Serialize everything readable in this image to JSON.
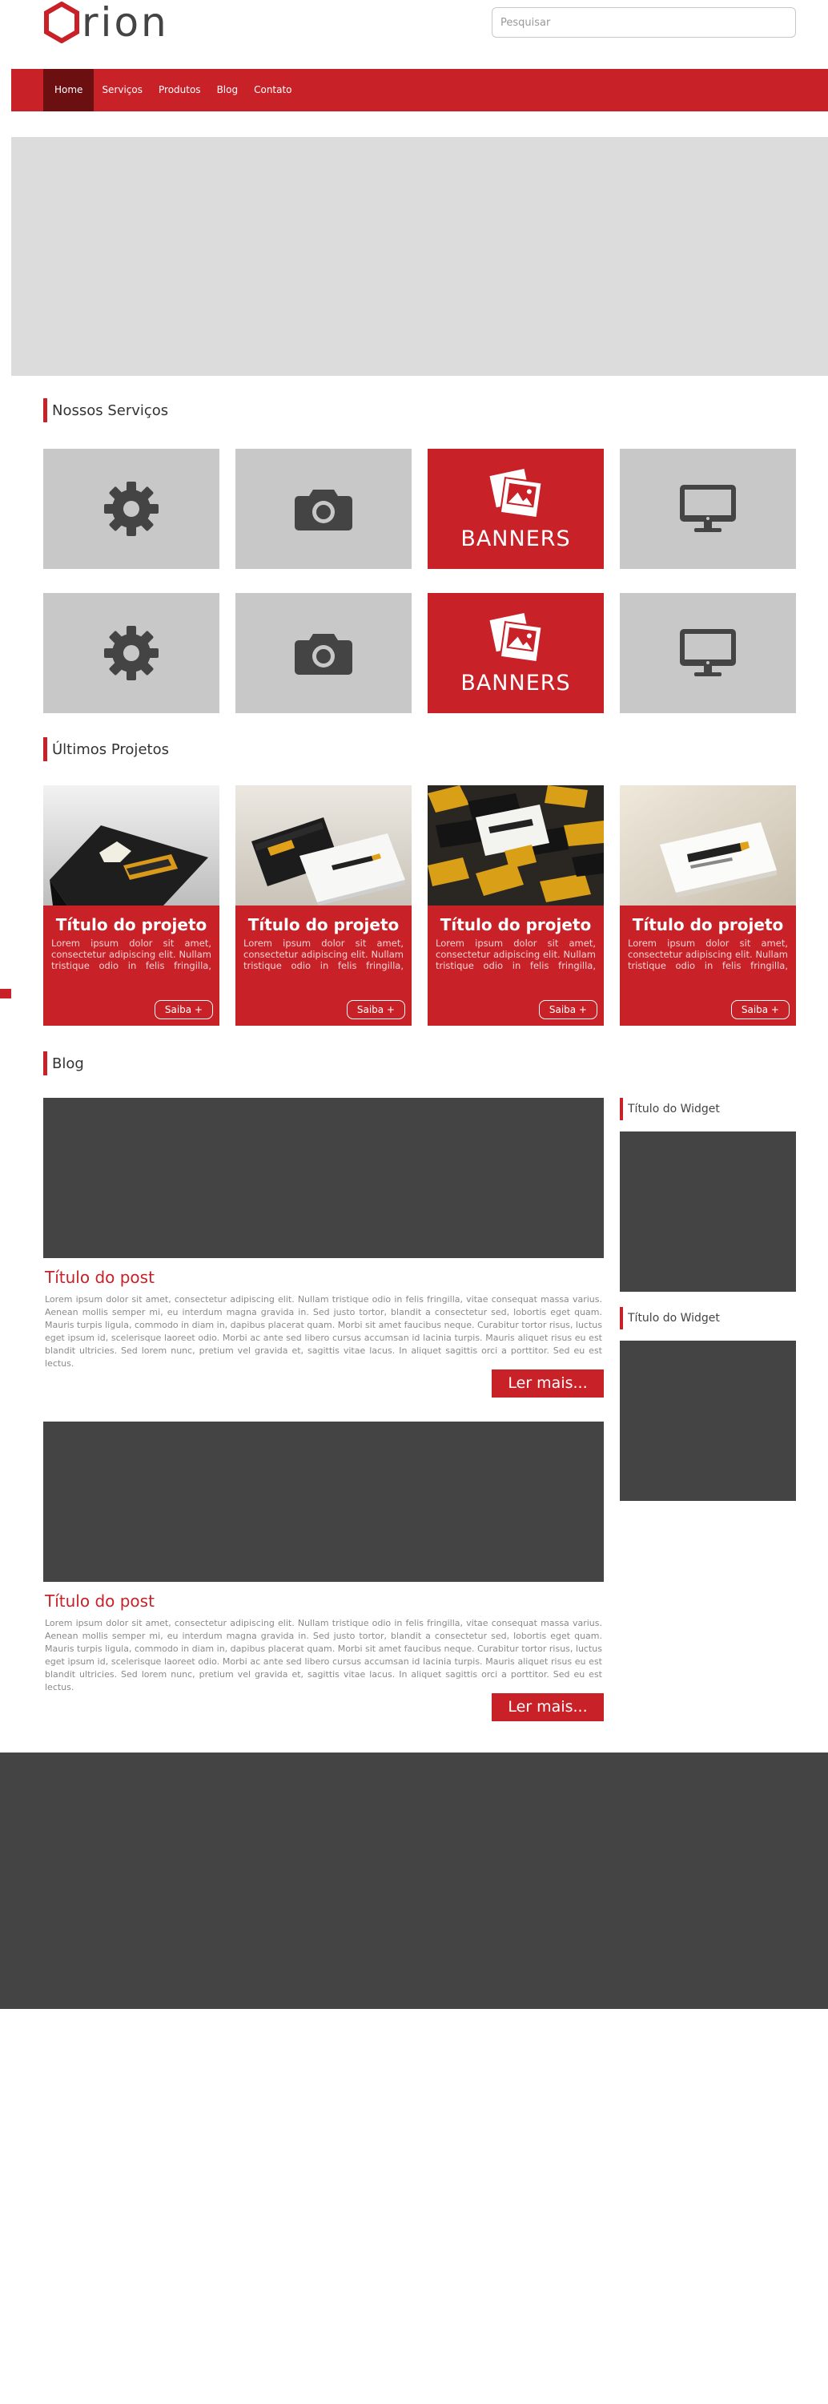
{
  "header": {
    "logo_text": "rion",
    "search_placeholder": "Pesquisar"
  },
  "nav": {
    "items": [
      "Home",
      "Serviços",
      "Produtos",
      "Blog",
      "Contato"
    ],
    "active": "Home"
  },
  "services": {
    "title": "Nossos Serviços",
    "tiles": [
      {
        "icon": "gear-icon"
      },
      {
        "icon": "camera-icon"
      },
      {
        "icon": "photos-icon",
        "label": "BANNERS"
      },
      {
        "icon": "monitor-icon"
      },
      {
        "icon": "gear-icon"
      },
      {
        "icon": "camera-icon"
      },
      {
        "icon": "photos-icon",
        "label": "BANNERS"
      },
      {
        "icon": "monitor-icon"
      }
    ]
  },
  "projects": {
    "title": "Últimos Projetos",
    "items": [
      {
        "title": "Título do projeto",
        "description": "Lorem ipsum dolor sit amet, consectetur adipiscing elit. Nullam tristique odio in felis fringilla, vitae consequat massa varius...",
        "button": "Saiba +"
      },
      {
        "title": "Título do projeto",
        "description": "Lorem ipsum dolor sit amet, consectetur adipiscing elit. Nullam tristique odio in felis fringilla, vitae consequat massa varius...",
        "button": "Saiba +"
      },
      {
        "title": "Título do projeto",
        "description": "Lorem ipsum dolor sit amet, consectetur adipiscing elit. Nullam tristique odio in felis fringilla, vitae consequat massa varius...",
        "button": "Saiba +"
      },
      {
        "title": "Título do projeto",
        "description": "Lorem ipsum dolor sit amet, consectetur adipiscing elit. Nullam tristique odio in felis fringilla, vitae consequat massa varius...",
        "button": "Saiba +"
      }
    ]
  },
  "blog": {
    "title": "Blog",
    "posts": [
      {
        "title": "Título do post",
        "text": "Lorem ipsum dolor sit amet, consectetur adipiscing elit. Nullam tristique odio in felis fringilla, vitae consequat massa varius. Aenean mollis semper mi, eu interdum magna gravida in. Sed justo tortor, blandit a consectetur sed, lobortis eget quam. Mauris turpis ligula, commodo in diam in, dapibus placerat quam. Morbi sit amet faucibus neque. Curabitur tortor risus, luctus eget ipsum id, scelerisque laoreet odio. Morbi ac ante sed libero cursus accumsan id lacinia turpis. Mauris aliquet risus eu est blandit ultricies. Sed lorem nunc, pretium vel gravida et, sagittis vitae lacus. In aliquet sagittis orci a porttitor. Sed eu est lectus.",
        "button": "Ler mais..."
      },
      {
        "title": "Título do post",
        "text": "Lorem ipsum dolor sit amet, consectetur adipiscing elit. Nullam tristique odio in felis fringilla, vitae consequat massa varius. Aenean mollis semper mi, eu interdum magna gravida in. Sed justo tortor, blandit a consectetur sed, lobortis eget quam. Mauris turpis ligula, commodo in diam in, dapibus placerat quam. Morbi sit amet faucibus neque. Curabitur tortor risus, luctus eget ipsum id, scelerisque laoreet odio. Morbi ac ante sed libero cursus accumsan id lacinia turpis. Mauris aliquet risus eu est blandit ultricies. Sed lorem nunc, pretium vel gravida et, sagittis vitae lacus. In aliquet sagittis orci a porttitor. Sed eu est lectus.",
        "button": "Ler mais..."
      }
    ]
  },
  "sidebar": {
    "widgets": [
      {
        "title": "Título do Widget"
      },
      {
        "title": "Título do Widget"
      }
    ]
  },
  "colors": {
    "accent": "#c82127",
    "accent_dark": "#6b0f11",
    "tile_gray": "#c8c8c8",
    "dark": "#444444"
  }
}
